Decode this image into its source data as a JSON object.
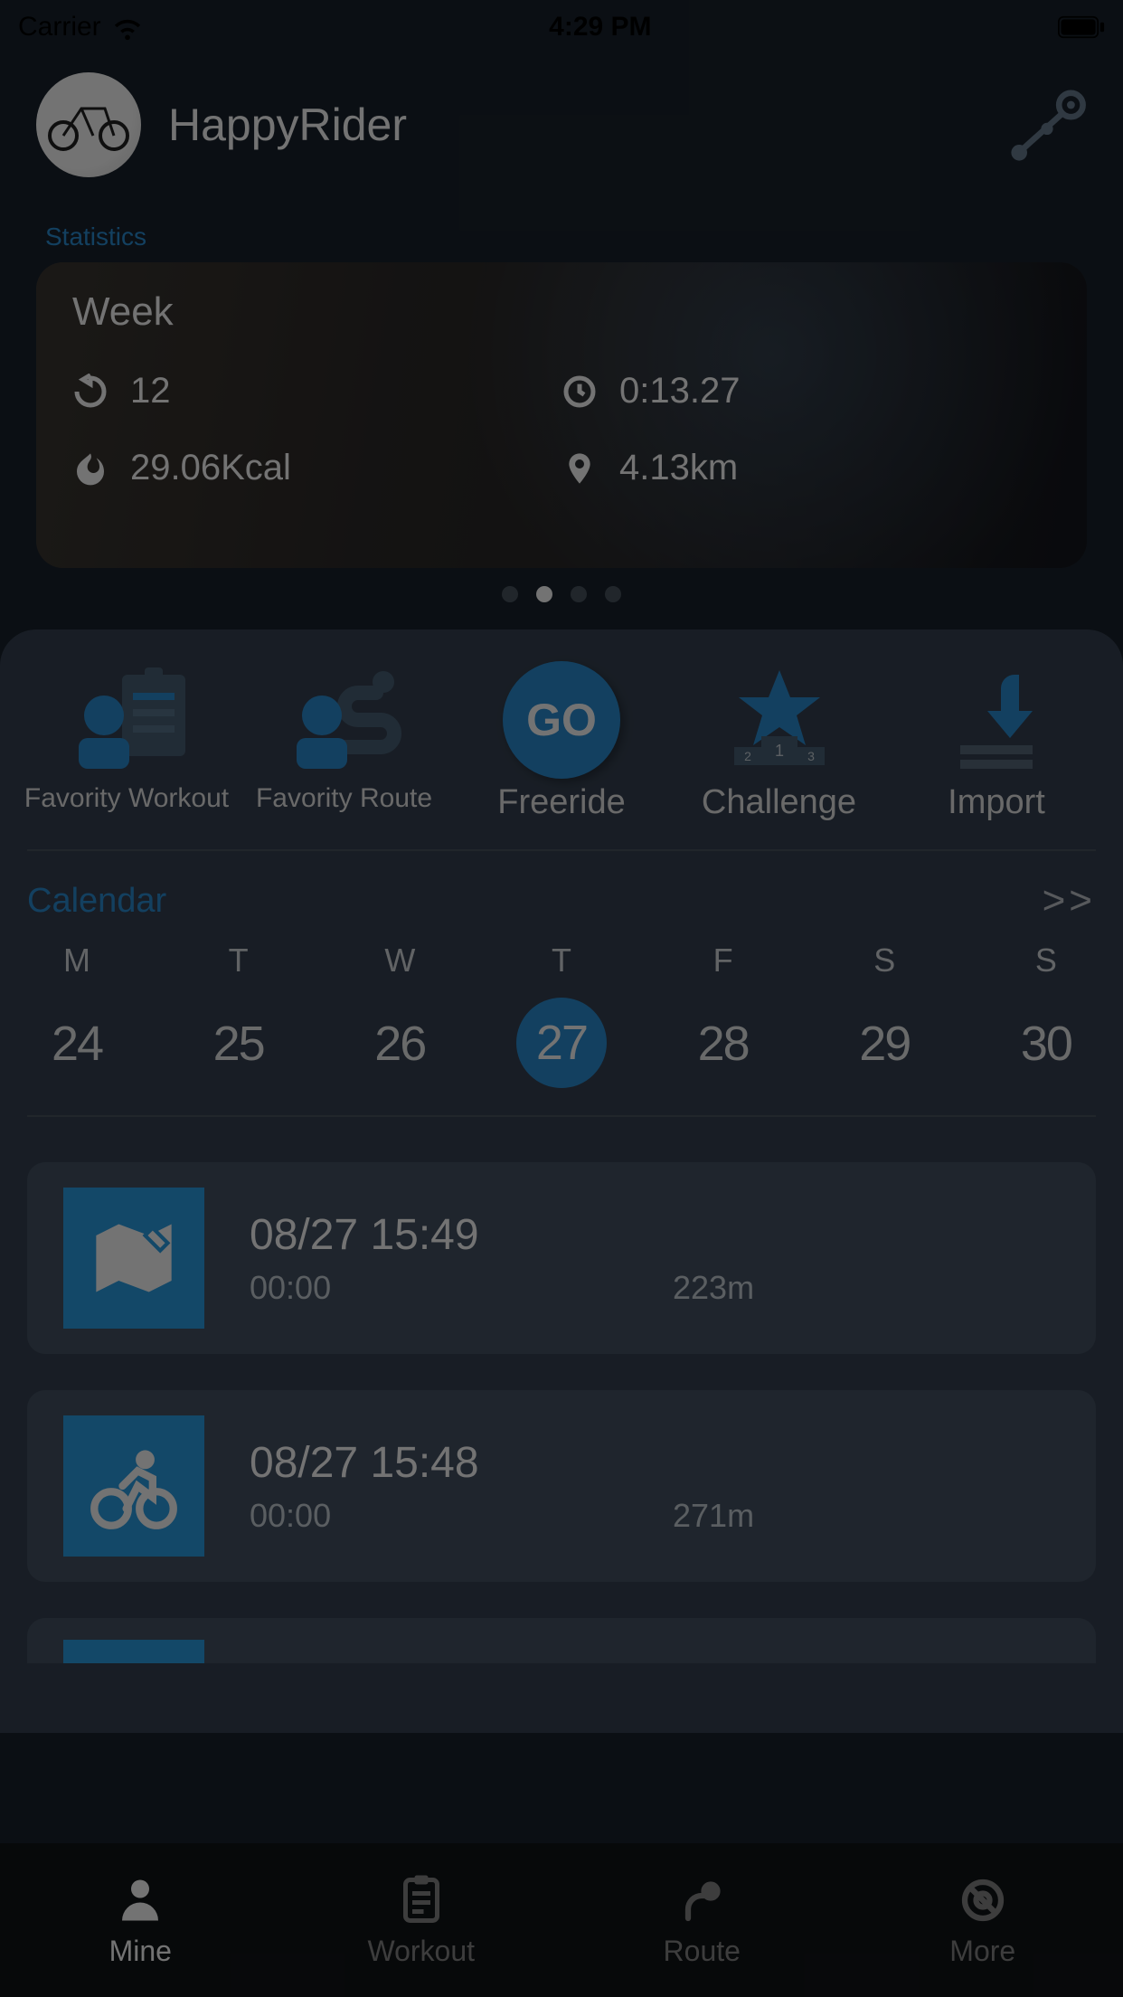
{
  "status": {
    "carrier": "Carrier",
    "time": "4:29 PM"
  },
  "profile": {
    "username": "HappyRider"
  },
  "stats": {
    "section_label": "Statistics",
    "title": "Week",
    "count": "12",
    "calories": "29.06Kcal",
    "duration": "0:13.27",
    "distance": "4.13km",
    "pager_active": 1,
    "pager_total": 4
  },
  "menu": {
    "items": [
      {
        "label": "Favority Workout"
      },
      {
        "label": "Favority Route"
      },
      {
        "label": "Freeride",
        "go": "GO"
      },
      {
        "label": "Challenge"
      },
      {
        "label": "Import"
      }
    ]
  },
  "calendar": {
    "label": "Calendar",
    "more": ">>",
    "days": [
      {
        "dow": "M",
        "num": "24"
      },
      {
        "dow": "T",
        "num": "25"
      },
      {
        "dow": "W",
        "num": "26"
      },
      {
        "dow": "T",
        "num": "27",
        "selected": true
      },
      {
        "dow": "F",
        "num": "28"
      },
      {
        "dow": "S",
        "num": "29"
      },
      {
        "dow": "S",
        "num": "30"
      }
    ]
  },
  "activities": [
    {
      "icon": "map",
      "title": "08/27 15:49",
      "duration": "00:00",
      "distance": "223m"
    },
    {
      "icon": "bike",
      "title": "08/27 15:48",
      "duration": "00:00",
      "distance": "271m"
    }
  ],
  "tabs": [
    {
      "label": "Mine",
      "active": true
    },
    {
      "label": "Workout"
    },
    {
      "label": "Route"
    },
    {
      "label": "More"
    }
  ]
}
